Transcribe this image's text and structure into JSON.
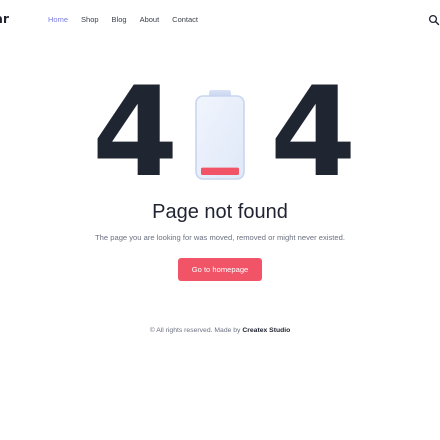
{
  "header": {
    "logo_text": "uar",
    "nav": [
      {
        "label": "Home",
        "active": true
      },
      {
        "label": "Shop",
        "active": false
      },
      {
        "label": "Blog",
        "active": false
      },
      {
        "label": "About",
        "active": false
      },
      {
        "label": "Contact",
        "active": false
      }
    ],
    "search_icon": "search-icon"
  },
  "hero": {
    "digit_left": "4",
    "digit_right": "4",
    "battery_icon": "battery-low-icon",
    "battery_level": 0.1
  },
  "main": {
    "title": "Page not found",
    "description": "The page you are looking for was moved, removed or might never existed.",
    "cta_label": "Go to homepage"
  },
  "footer": {
    "text": "© All rights reserved. Made by",
    "brand": "Createx Studio"
  },
  "colors": {
    "accent": "#f05466",
    "nav_active": "#7a7de0",
    "text_dark": "#1f2430",
    "text_muted": "#6b7180"
  }
}
